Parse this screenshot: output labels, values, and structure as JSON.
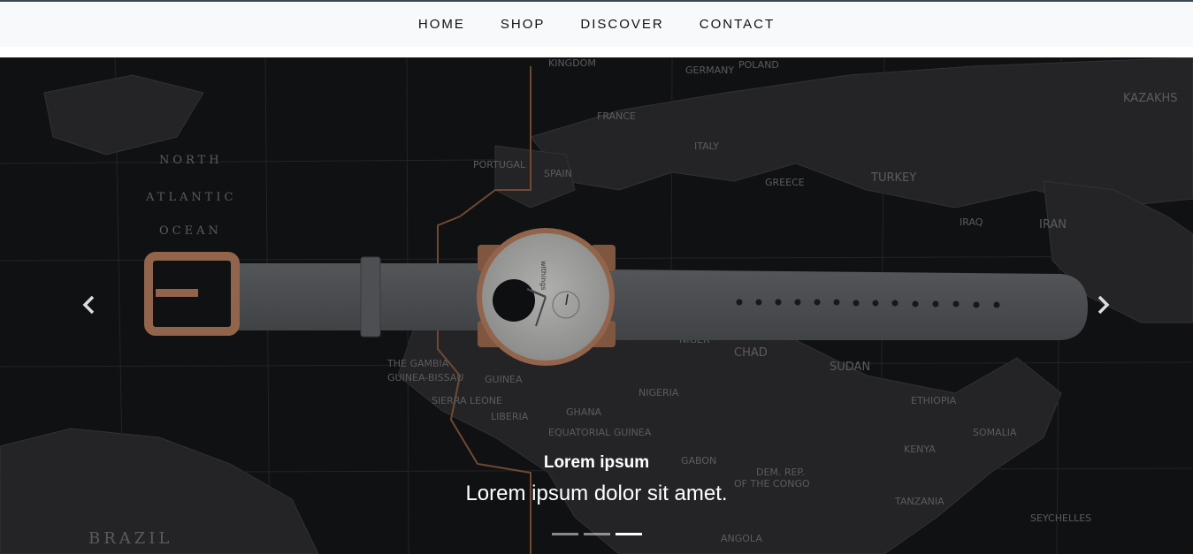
{
  "nav": {
    "items": [
      {
        "label": "HOME"
      },
      {
        "label": "SHOP"
      },
      {
        "label": "DISCOVER"
      },
      {
        "label": "CONTACT"
      }
    ]
  },
  "carousel": {
    "caption_title": "Lorem ipsum",
    "caption_text": "Lorem ipsum dolor sit amet.",
    "prev_icon": "chevron-left-icon",
    "next_icon": "chevron-right-icon",
    "slide_count": 3,
    "active_slide": 3,
    "background_image": "watch on world map",
    "watch_brand": "withings",
    "map_labels": [
      "NORTH",
      "ATLANTIC",
      "OCEAN",
      "BRAZIL",
      "KINGDOM",
      "GERMANY",
      "POLAND",
      "FRANCE",
      "SPAIN",
      "PORTUGAL",
      "ITALY",
      "GREECE",
      "TURKEY",
      "IRAN",
      "IRAQ",
      "KAZAKHS",
      "SUDAN",
      "CHAD",
      "NIGER",
      "NIGERIA",
      "ETHIOPIA",
      "SOMALIA",
      "KENYA",
      "TANZANIA",
      "ANGOLA",
      "DEM. REP. OF THE CONGO",
      "GHANA",
      "THE GAMBIA",
      "GUINEA-BISSAU",
      "GUINEA",
      "SIERRA LEONE",
      "LIBERIA",
      "EQUATORIAL GUINEA",
      "GABON",
      "SEYCHELLES"
    ]
  },
  "colors": {
    "nav_bg": "#f8f9fa",
    "carousel_bg": "#111214",
    "strap": "#5a5d61",
    "rose_gold": "#b27a5c"
  }
}
